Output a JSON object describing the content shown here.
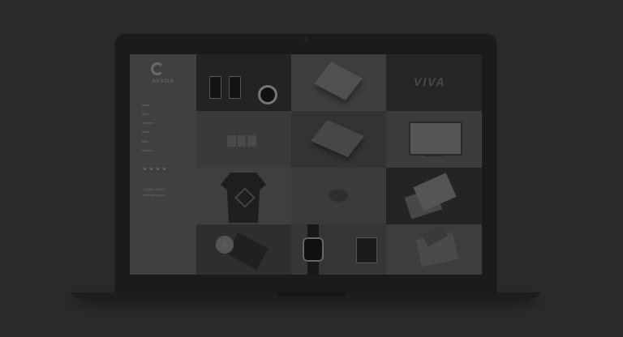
{
  "site": {
    "logo_text": "AVADA",
    "brand_word": "VIVA",
    "nav": [
      "Home",
      "Work",
      "Services",
      "About",
      "Blog",
      "Contact"
    ],
    "contact": [
      "+1 (555) 123-4567",
      "info@agency.com"
    ]
  },
  "portfolio": {
    "tiles": [
      {
        "name": "mobile-app-and-vinyl"
      },
      {
        "name": "hardcover-book"
      },
      {
        "name": "brand-logotype"
      },
      {
        "name": "business-cards"
      },
      {
        "name": "letter-envelope"
      },
      {
        "name": "desktop-website"
      },
      {
        "name": "tshirt-print"
      },
      {
        "name": "chat-bubble-logo"
      },
      {
        "name": "magazine-spread"
      },
      {
        "name": "cd-packaging"
      },
      {
        "name": "smartwatch-and-tag"
      },
      {
        "name": "packaging-box"
      }
    ]
  },
  "colors": {
    "background": "#2a2a2a",
    "laptop": "#1b1b1b"
  }
}
